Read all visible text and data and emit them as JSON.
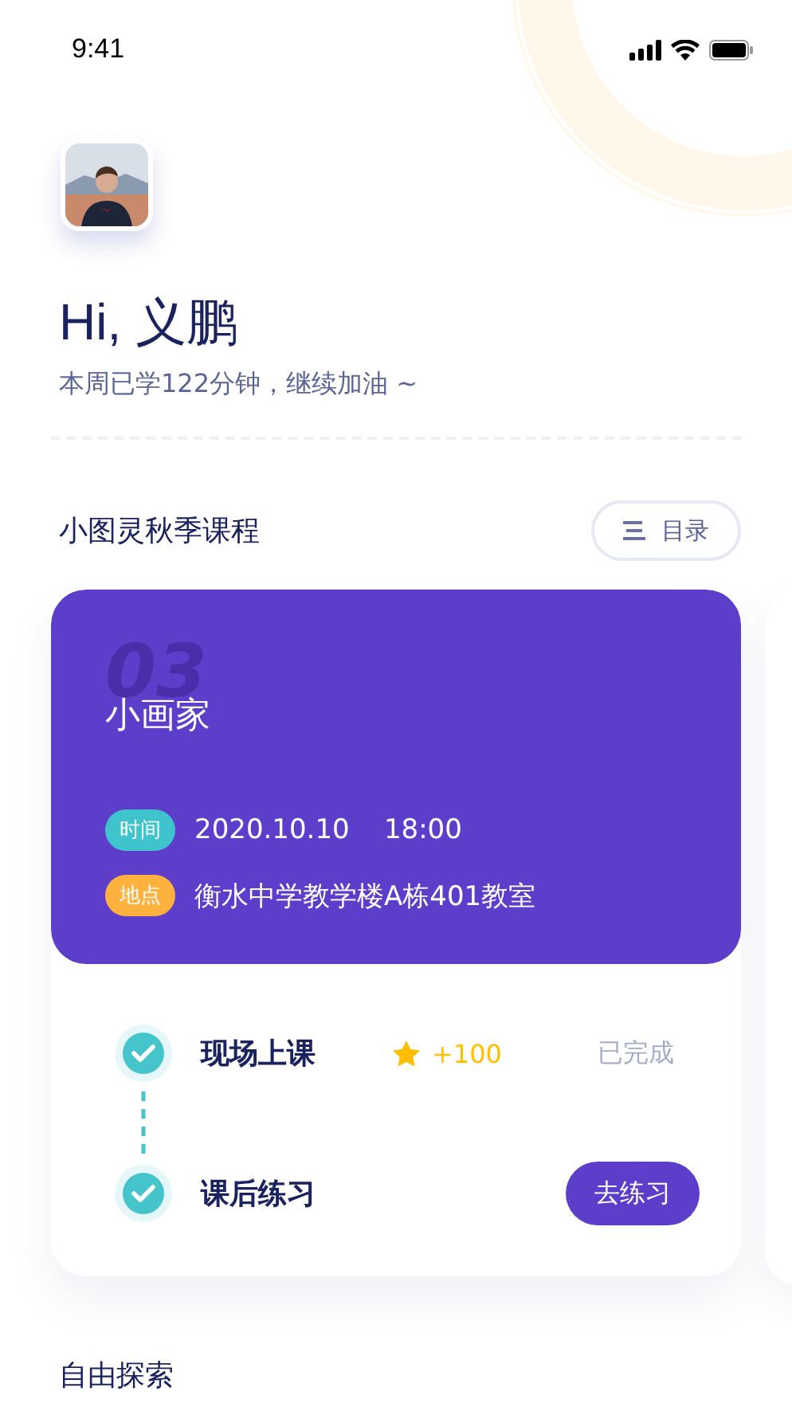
{
  "status_bar": {
    "time": "9:41"
  },
  "greeting": {
    "title": "Hi, 义鹏",
    "subtitle": "本周已学122分钟，继续加油 ~"
  },
  "course_section": {
    "title": "小图灵秋季课程",
    "catalog_button": "目录"
  },
  "lesson": {
    "number": "03",
    "title": "小画家",
    "details": [
      {
        "tag": "时间",
        "color": "#3fc3cc",
        "text": "2020.10.10    18:00"
      },
      {
        "tag": "地点",
        "color": "#ffb13d",
        "text": "衡水中学教学楼A栋401教室"
      }
    ],
    "steps": [
      {
        "kind": "reward",
        "title": "现场上课",
        "checked": true,
        "reward": "+100",
        "status": "已完成"
      },
      {
        "kind": "action",
        "title": "课后练习",
        "checked": true,
        "button": "去练习"
      }
    ]
  },
  "explore_section": {
    "title": "自由探索"
  }
}
